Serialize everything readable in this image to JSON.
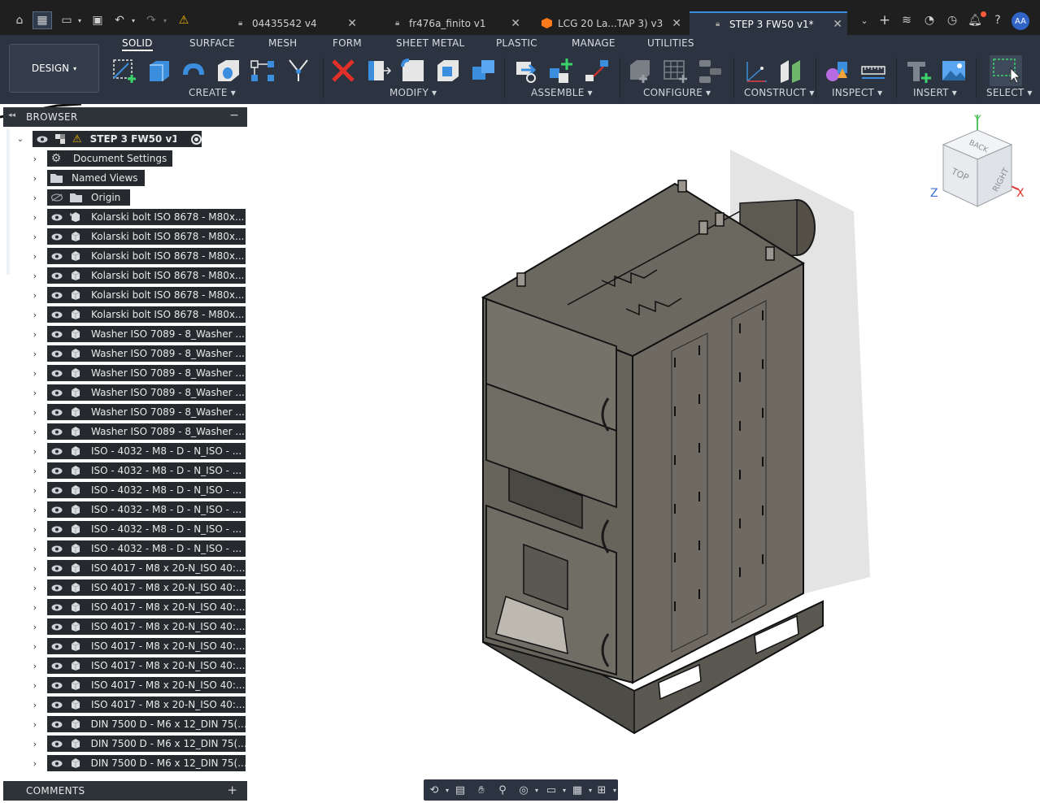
{
  "tabs": [
    {
      "label": "04435542 v4",
      "active": false
    },
    {
      "label": "fr476a_finito v1",
      "active": false
    },
    {
      "label": "LCG 20 La...TAP 3) v3",
      "active": false
    },
    {
      "label": "STEP 3 FW50 v1*",
      "active": true
    }
  ],
  "user": {
    "initials": "AA"
  },
  "workspace": {
    "label": "DESIGN"
  },
  "ribbon_tabs": [
    "SOLID",
    "SURFACE",
    "MESH",
    "FORM",
    "SHEET METAL",
    "PLASTIC",
    "MANAGE",
    "UTILITIES"
  ],
  "ribbon_groups": [
    "CREATE",
    "MODIFY",
    "ASSEMBLE",
    "CONFIGURE",
    "CONSTRUCT",
    "INSPECT",
    "INSERT",
    "SELECT"
  ],
  "browser": {
    "title": "BROWSER",
    "root": "STEP 3 FW50 v1",
    "items": [
      "Document Settings",
      "Named Views",
      "Origin",
      "Kolarski bolt ISO 8678 - M80x...",
      "Kolarski bolt ISO 8678 - M80x...",
      "Kolarski bolt ISO 8678 - M80x...",
      "Kolarski bolt ISO 8678 - M80x...",
      "Kolarski bolt ISO 8678 - M80x...",
      "Kolarski bolt ISO 8678 - M80x...",
      "Washer ISO 7089 - 8_Washer ...",
      "Washer ISO 7089 - 8_Washer ...",
      "Washer ISO 7089 - 8_Washer ...",
      "Washer ISO 7089 - 8_Washer ...",
      "Washer ISO 7089 - 8_Washer ...",
      "Washer ISO 7089 - 8_Washer ...",
      "ISO - 4032 - M8 - D - N_ISO - ...",
      "ISO - 4032 - M8 - D - N_ISO - ...",
      "ISO - 4032 - M8 - D - N_ISO - ...",
      "ISO - 4032 - M8 - D - N_ISO - ...",
      "ISO - 4032 - M8 - D - N_ISO - ...",
      "ISO - 4032 - M8 - D - N_ISO - ...",
      "ISO 4017 - M8 x 20-N_ISO 40:...",
      "ISO 4017 - M8 x 20-N_ISO 40:...",
      "ISO 4017 - M8 x 20-N_ISO 40:...",
      "ISO 4017 - M8 x 20-N_ISO 40:...",
      "ISO 4017 - M8 x 20-N_ISO 40:...",
      "ISO 4017 - M8 x 20-N_ISO 40:...",
      "ISO 4017 - M8 x 20-N_ISO 40:...",
      "ISO 4017 - M8 x 20-N_ISO 40:...",
      "DIN 7500 D - M6 x 12_DIN 75(...",
      "DIN 7500 D - M6 x 12_DIN 75(...",
      "DIN 7500 D - M6 x 12_DIN 75(..."
    ]
  },
  "comments": {
    "title": "COMMENTS"
  },
  "viewcube": {
    "top": "TOP",
    "right": "RIGHT",
    "back": "BACK",
    "axis_x": "X",
    "axis_y": "Y",
    "axis_z": "Z"
  },
  "colors": {
    "accent": "#3b8ede",
    "ribbon_bg": "#2b3440",
    "panel_bg": "#262a2f",
    "warning": "#f4b400",
    "delete_red": "#e0302a"
  }
}
